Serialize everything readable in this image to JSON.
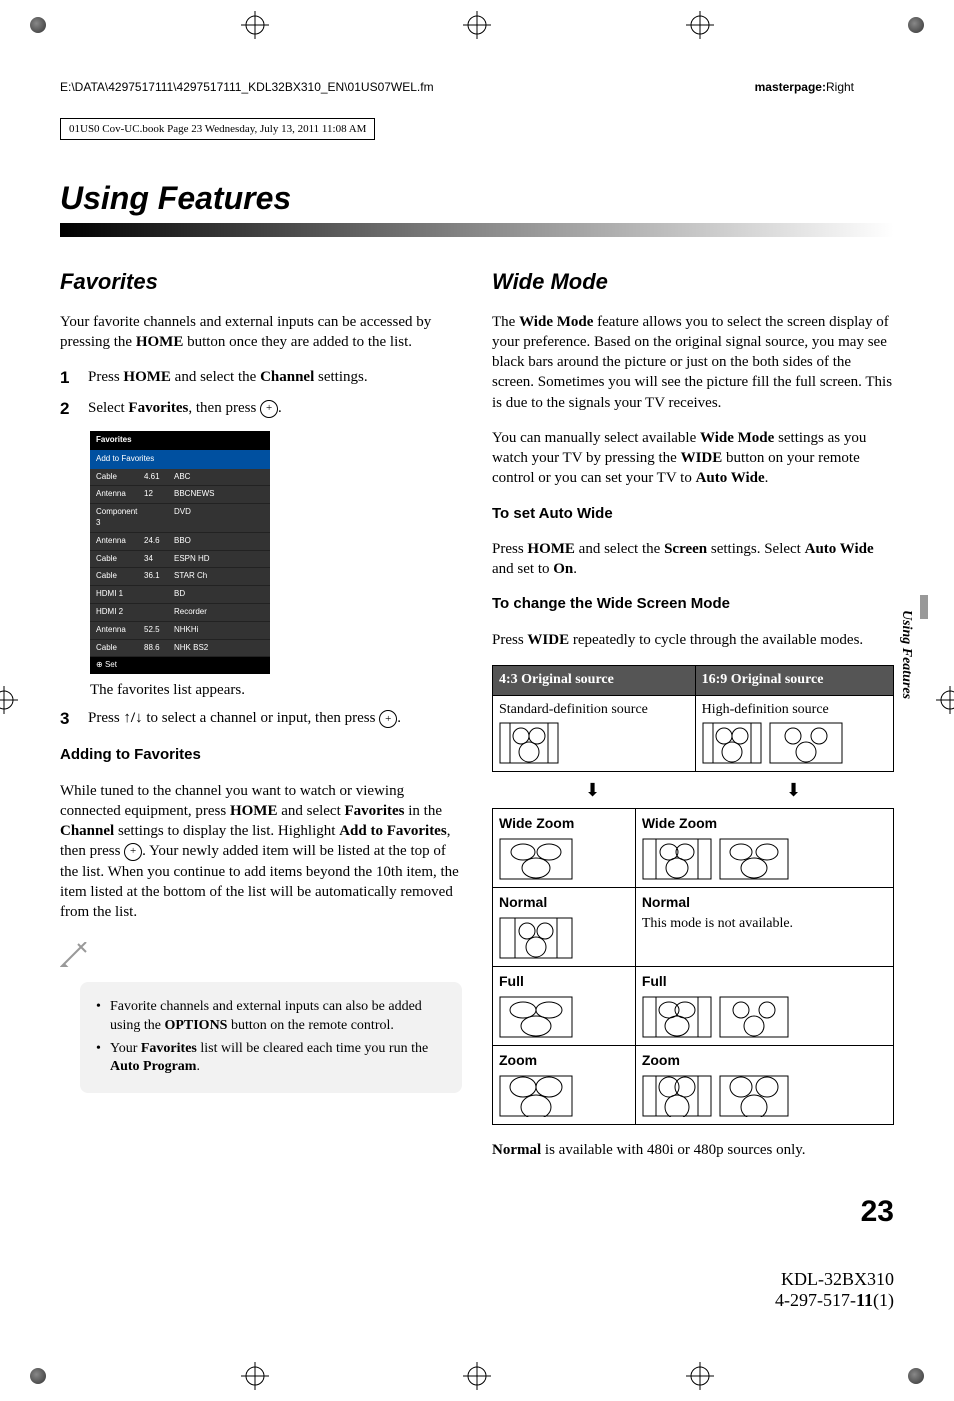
{
  "header": {
    "path": "E:\\DATA\\4297517111\\4297517111_KDL32BX310_EN\\01US07WEL.fm",
    "masterpage_label": "masterpage:",
    "masterpage_value": "Right",
    "box_text": "01US0 Cov-UC.book  Page 23  Wednesday, July 13, 2011  11:08 AM"
  },
  "chapter_title": "Using Features",
  "side_tab": "Using Features",
  "left": {
    "title": "Favorites",
    "intro_1": "Your favorite channels and external inputs can be accessed by pressing the ",
    "intro_home": "HOME",
    "intro_2": " button once they are added to the list.",
    "step1_a": "Press ",
    "step1_home": "HOME",
    "step1_b": " and select the ",
    "step1_channel": "Channel",
    "step1_c": " settings.",
    "step2_a": "Select ",
    "step2_fav": "Favorites",
    "step2_b": ", then press ",
    "step2_c": ".",
    "fav_table": {
      "title": "Favorites",
      "add": "Add to Favorites",
      "rows": [
        [
          "Cable",
          "4.61",
          "ABC"
        ],
        [
          "Antenna",
          "12",
          "BBCNEWS"
        ],
        [
          "Component 3",
          "",
          "DVD"
        ],
        [
          "Antenna",
          "24.6",
          "BBO"
        ],
        [
          "Cable",
          "34",
          "ESPN HD"
        ],
        [
          "Cable",
          "36.1",
          "STAR Ch"
        ],
        [
          "HDMI 1",
          "",
          "BD"
        ],
        [
          "HDMI 2",
          "",
          "Recorder"
        ],
        [
          "Antenna",
          "52.5",
          "NHKHi"
        ],
        [
          "Cable",
          "88.6",
          "NHK BS2"
        ]
      ],
      "footer": "Set"
    },
    "fav_caption": "The favorites list appears.",
    "step3_a": "Press ",
    "step3_arrows": "↑/↓",
    "step3_b": " to select a channel or input, then press ",
    "step3_c": ".",
    "adding_title": "Adding to Favorites",
    "adding_p1a": "While tuned to the channel you want to watch or viewing connected equipment, press ",
    "adding_home": "HOME",
    "adding_p1b": " and select ",
    "adding_fav": "Favorites",
    "adding_p1c": " in the ",
    "adding_channel": "Channel",
    "adding_p1d": " settings to display the list. Highlight ",
    "adding_addto": "Add to Favorites",
    "adding_p1e": ", then press ",
    "adding_p1f": ". Your newly added item will be listed at the top of the list. When you continue to add items beyond the 10th item, the item listed at the bottom of the list will be automatically removed from the list.",
    "tip1_a": "Favorite channels and external inputs can also be added using the ",
    "tip1_opt": "OPTIONS",
    "tip1_b": " button on the remote control.",
    "tip2_a": "Your ",
    "tip2_fav": "Favorites",
    "tip2_b": " list will be cleared each time you run the ",
    "tip2_auto": "Auto Program",
    "tip2_c": "."
  },
  "right": {
    "title": "Wide Mode",
    "p1_a": "The ",
    "p1_wm": "Wide Mode",
    "p1_b": " feature allows you to select the screen display of your preference. Based on the original signal source, you may see black bars around the picture or just on the both sides of the screen. Sometimes you will see the picture fill the full screen. This is due to the signals your TV receives.",
    "p2_a": "You can manually select available ",
    "p2_wm": "Wide Mode",
    "p2_b": " settings as you watch your TV by pressing the ",
    "p2_wide": "WIDE",
    "p2_c": " button on your remote control or you can set your TV to ",
    "p2_aw": "Auto Wide",
    "p2_d": ".",
    "set_auto_title": "To set Auto Wide",
    "set_auto_a": "Press ",
    "set_auto_home": "HOME",
    "set_auto_b": " and select the ",
    "set_auto_screen": "Screen",
    "set_auto_c": " settings. Select ",
    "set_auto_aw": "Auto Wide",
    "set_auto_d": " and set to ",
    "set_auto_on": "On",
    "set_auto_e": ".",
    "change_title": "To change the Wide Screen Mode",
    "change_a": "Press ",
    "change_wide": "WIDE",
    "change_b": " repeatedly to cycle through the available modes.",
    "table": {
      "h1": "4:3 Original source",
      "h2": "16:9 Original source",
      "src1": "Standard-definition source",
      "src2": "High-definition source",
      "wide_zoom": "Wide Zoom",
      "normal": "Normal",
      "normal_na": "This mode is not available.",
      "full": "Full",
      "zoom": "Zoom"
    },
    "note_a": "Normal",
    "note_b": " is available with 480i or 480p sources only."
  },
  "page_number": "23",
  "footer_model": "KDL-32BX310",
  "footer_code_a": "4-297-517-",
  "footer_code_b": "11",
  "footer_code_c": "(1)"
}
